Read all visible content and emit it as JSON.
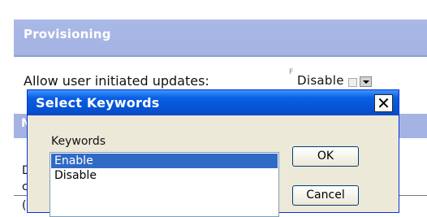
{
  "provisioning": {
    "title": "Provisioning",
    "setting_label": "Allow user initiated updates:",
    "setting_value": "Disable",
    "corner_mark": "F"
  },
  "background_fragments": {
    "row_header": "N",
    "line_a": "D",
    "line_b": "c",
    "line_c": "("
  },
  "dialog": {
    "title": "Select Keywords",
    "close_glyph": "✕",
    "keywords_label": "Keywords",
    "items": [
      {
        "label": "Enable",
        "selected": true
      },
      {
        "label": "Disable",
        "selected": false
      }
    ],
    "ok_label": "OK",
    "cancel_label": "Cancel"
  }
}
